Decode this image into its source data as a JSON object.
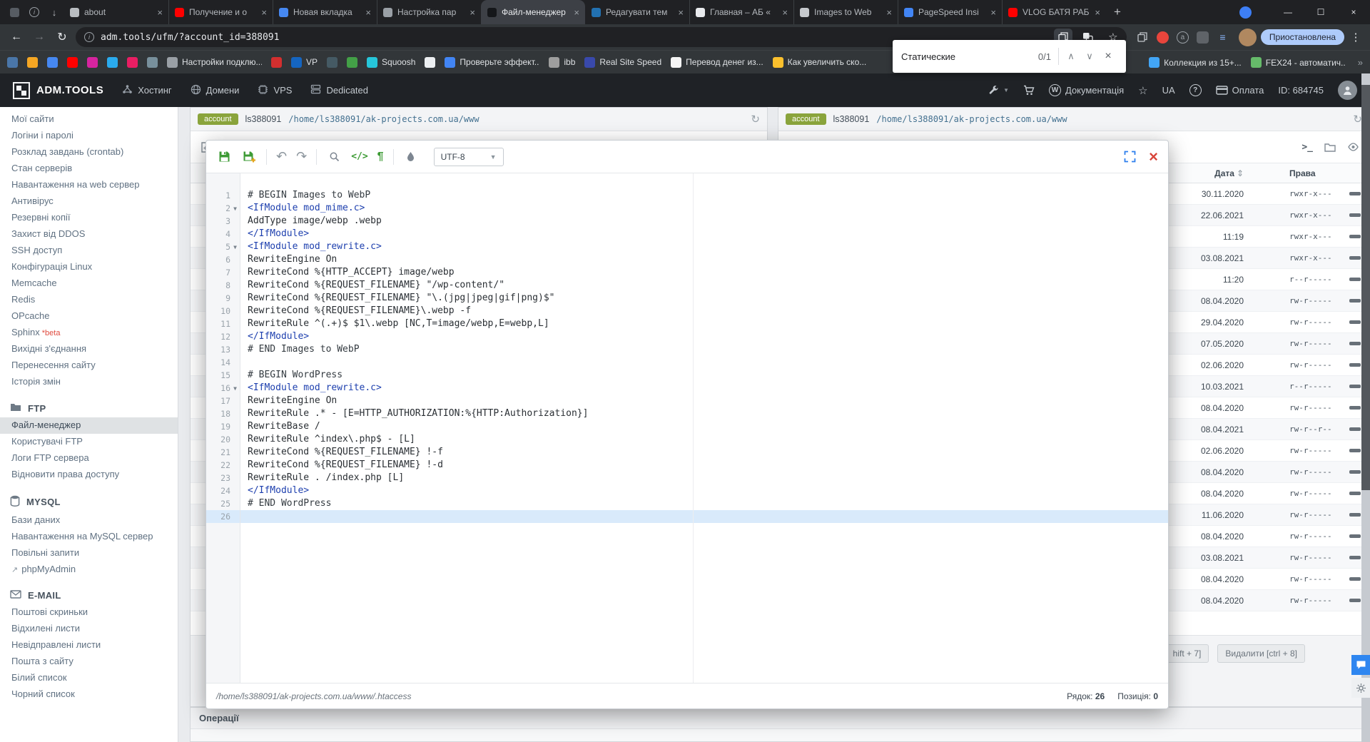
{
  "browser": {
    "pinned_tabs": [
      "app-icon",
      "info-icon",
      "download-icon"
    ],
    "tabs": [
      {
        "label": "about",
        "fav": "#b9bdc1",
        "active": false
      },
      {
        "label": "Получение и о",
        "fav": "#ff0000",
        "active": false
      },
      {
        "label": "Новая вкладка",
        "fav": "#4688f1",
        "active": false
      },
      {
        "label": "Настройка пар",
        "fav": "#9aa0a6",
        "active": false
      },
      {
        "label": "Файл-менеджер",
        "fav": "#15171a",
        "active": true
      },
      {
        "label": "Редагувати тем",
        "fav": "#2271b1",
        "active": false
      },
      {
        "label": "Главная – АБ «",
        "fav": "#e8eaed",
        "active": false
      },
      {
        "label": "Images to Web",
        "fav": "#c6c9cd",
        "active": false
      },
      {
        "label": "PageSpeed Insi",
        "fav": "#4285f4",
        "active": false
      },
      {
        "label": "VLOG БАТЯ РАБ",
        "fav": "#ff0000",
        "active": false
      }
    ],
    "url": "adm.tools/ufm/?account_id=388091",
    "find": {
      "query": "Статические",
      "count": "0/1"
    },
    "profile_label": "Приостановлена",
    "extensions": [
      {
        "name": "copy-icon",
        "color": "#c3c7cc"
      },
      {
        "name": "adblock-icon",
        "color": "#e8453c"
      },
      {
        "name": "a-icon",
        "color": "#9aa0a6"
      },
      {
        "name": "dark-icon",
        "color": "#5f6368"
      },
      {
        "name": "lines-icon",
        "color": "#8ab4f8"
      }
    ],
    "bookmarks": [
      {
        "color": "#4a76a8"
      },
      {
        "color": "#f5a623"
      },
      {
        "color": "#4688f1"
      },
      {
        "color": "#ff0000"
      },
      {
        "color": "#d6249f"
      },
      {
        "color": "#2aabee"
      },
      {
        "color": "#e91e63"
      },
      {
        "color": "#78909c"
      },
      {
        "label": "Настройки подклю...",
        "color": "#9aa0a6"
      },
      {
        "color": "#d32f2f"
      },
      {
        "label": "VP",
        "color": "#1565c0"
      },
      {
        "color": "#455a64"
      },
      {
        "color": "#43a047"
      },
      {
        "label": "Squoosh",
        "color": "#26c6da"
      },
      {
        "color": "#eceff1"
      },
      {
        "label": "Проверьте эффект...",
        "color": "#4285f4"
      },
      {
        "label": "ibb",
        "color": "#9e9e9e"
      },
      {
        "label": "Real Site Speed",
        "color": "#3949ab"
      },
      {
        "label": "Перевод денег из...",
        "color": "#f5f5f5"
      },
      {
        "label": "Как увеличить ско...",
        "color": "#fbc02d"
      }
    ],
    "bookmarks_right": [
      {
        "label": "Коллекция из 15+...",
        "color": "#42a5f5"
      },
      {
        "label": "FEX24 - автоматич...",
        "color": "#66bb6a"
      }
    ],
    "overflow_chevron": "»"
  },
  "app_header": {
    "logo_text": "ADM.TOOLS",
    "nav": [
      {
        "label": "Хостинг",
        "icon": "hosting-icon"
      },
      {
        "label": "Домени",
        "icon": "domains-icon"
      },
      {
        "label": "VPS",
        "icon": "vps-icon"
      },
      {
        "label": "Dedicated",
        "icon": "dedicated-icon"
      }
    ],
    "docs_label": "Документація",
    "lang": "UA",
    "help_label": "?",
    "pay_label": "Оплата",
    "account_id": "ID: 684745"
  },
  "sidebar": {
    "items": [
      {
        "label": "Мої сайти"
      },
      {
        "label": "Логіни і паролі"
      },
      {
        "label": "Розклад завдань (crontab)"
      },
      {
        "label": "Стан серверів"
      },
      {
        "label": "Навантаження на web сервер"
      },
      {
        "label": "Антивірус"
      },
      {
        "label": "Резервні копії"
      },
      {
        "label": "Захист від DDOS"
      },
      {
        "label": "SSH доступ"
      },
      {
        "label": "Конфігурація Linux"
      },
      {
        "label": "Memcache"
      },
      {
        "label": "Redis"
      },
      {
        "label": "OPcache"
      },
      {
        "label": "Sphinx",
        "beta": "*beta"
      },
      {
        "label": "Вихідні з'єднання"
      },
      {
        "label": "Перенесення сайту"
      },
      {
        "label": "Історія змін"
      }
    ],
    "sections": [
      {
        "title": "FTP",
        "icon": "folder-icon",
        "items": [
          {
            "label": "Файл-менеджер",
            "selected": true
          },
          {
            "label": "Користувачі FTP"
          },
          {
            "label": "Логи FTP сервера"
          },
          {
            "label": "Відновити права доступу"
          }
        ]
      },
      {
        "title": "MYSQL",
        "icon": "database-icon",
        "items": [
          {
            "label": "Бази даних"
          },
          {
            "label": "Навантаження на MySQL сервер"
          },
          {
            "label": "Повільні запити"
          },
          {
            "label": "phpMyAdmin",
            "external": true
          }
        ]
      },
      {
        "title": "E-MAIL",
        "icon": "mail-icon",
        "items": [
          {
            "label": "Поштові скриньки"
          },
          {
            "label": "Відхилені листи"
          },
          {
            "label": "Невідправлені листи"
          },
          {
            "label": "Пошта з сайту"
          },
          {
            "label": "Білий список"
          },
          {
            "label": "Чорний список"
          }
        ]
      }
    ]
  },
  "panes": {
    "account_label": "account",
    "login": "ls388091",
    "path": "/home/ls388091/ak-projects.com.ua/www",
    "columns": {
      "date": "Дата",
      "perms": "Права"
    },
    "toolbar_icons": [
      "new-file-icon",
      "new-folder-icon",
      "upload-icon",
      "refresh-icon",
      "search-icon"
    ],
    "toolbar_right_icons": [
      "terminal-icon",
      "folder-icon",
      "eye-icon"
    ],
    "rows": [
      {
        "date": "30.11.2020",
        "perms": "rwxr-x---"
      },
      {
        "date": "22.06.2021",
        "perms": "rwxr-x---"
      },
      {
        "date": "11:19",
        "perms": "rwxr-x---"
      },
      {
        "date": "03.08.2021",
        "perms": "rwxr-x---"
      },
      {
        "date": "11:20",
        "perms": "r--r-----"
      },
      {
        "date": "08.04.2020",
        "perms": "rw-r-----"
      },
      {
        "date": "29.04.2020",
        "perms": "rw-r-----"
      },
      {
        "date": "07.05.2020",
        "perms": "rw-r-----"
      },
      {
        "date": "02.06.2020",
        "perms": "rw-r-----"
      },
      {
        "date": "10.03.2021",
        "perms": "r--r-----"
      },
      {
        "date": "08.04.2020",
        "perms": "rw-r-----"
      },
      {
        "date": "08.04.2021",
        "perms": "rw-r--r--"
      },
      {
        "date": "02.06.2020",
        "perms": "rw-r-----"
      },
      {
        "date": "08.04.2020",
        "perms": "rw-r-----"
      },
      {
        "date": "08.04.2020",
        "perms": "rw-r-----"
      },
      {
        "date": "11.06.2020",
        "perms": "rw-r-----"
      },
      {
        "date": "08.04.2020",
        "perms": "rw-r-----"
      },
      {
        "date": "03.08.2021",
        "perms": "rw-r-----"
      },
      {
        "date": "08.04.2020",
        "perms": "rw-r-----"
      },
      {
        "date": "08.04.2020",
        "perms": "rw-r-----"
      }
    ],
    "empty_rows": 20,
    "footer_buttons": [
      {
        "label": "hift + 7]"
      },
      {
        "label": "Видалити [ctrl + 8]"
      }
    ],
    "operations_title": "Операції"
  },
  "editor": {
    "encoding": "UTF-8",
    "code_label": "</>",
    "para_label": "¶",
    "current_line": 26,
    "lines": [
      {
        "t": "# BEGIN Images to WebP",
        "c": "cm"
      },
      {
        "t": "<IfModule mod_mime.c>",
        "c": "tag",
        "f": true
      },
      {
        "t": "AddType image/webp .webp",
        "c": ""
      },
      {
        "t": "</IfModule>",
        "c": "tag"
      },
      {
        "t": "<IfModule mod_rewrite.c>",
        "c": "tag",
        "f": true
      },
      {
        "t": "RewriteEngine On",
        "c": ""
      },
      {
        "t": "RewriteCond %{HTTP_ACCEPT} image/webp",
        "c": ""
      },
      {
        "t": "RewriteCond %{REQUEST_FILENAME} \"/wp-content/\"",
        "c": ""
      },
      {
        "t": "RewriteCond %{REQUEST_FILENAME} \"\\.(jpg|jpeg|gif|png)$\"",
        "c": ""
      },
      {
        "t": "RewriteCond %{REQUEST_FILENAME}\\.webp -f",
        "c": ""
      },
      {
        "t": "RewriteRule ^(.+)$ $1\\.webp [NC,T=image/webp,E=webp,L]",
        "c": ""
      },
      {
        "t": "</IfModule>",
        "c": "tag"
      },
      {
        "t": "# END Images to WebP",
        "c": "cm"
      },
      {
        "t": "",
        "c": ""
      },
      {
        "t": "# BEGIN WordPress",
        "c": "cm"
      },
      {
        "t": "<IfModule mod_rewrite.c>",
        "c": "tag",
        "f": true
      },
      {
        "t": "RewriteEngine On",
        "c": ""
      },
      {
        "t": "RewriteRule .* - [E=HTTP_AUTHORIZATION:%{HTTP:Authorization}]",
        "c": ""
      },
      {
        "t": "RewriteBase /",
        "c": ""
      },
      {
        "t": "RewriteRule ^index\\.php$ - [L]",
        "c": ""
      },
      {
        "t": "RewriteCond %{REQUEST_FILENAME} !-f",
        "c": ""
      },
      {
        "t": "RewriteCond %{REQUEST_FILENAME} !-d",
        "c": ""
      },
      {
        "t": "RewriteRule . /index.php [L]",
        "c": ""
      },
      {
        "t": "</IfModule>",
        "c": "tag"
      },
      {
        "t": "# END WordPress",
        "c": "cm"
      },
      {
        "t": "",
        "c": ""
      }
    ],
    "file_path": "/home/ls388091/ak-projects.com.ua/www/.htaccess",
    "status_line_label": "Рядок:",
    "status_line": "26",
    "status_col_label": "Позиція:",
    "status_col": "0"
  }
}
